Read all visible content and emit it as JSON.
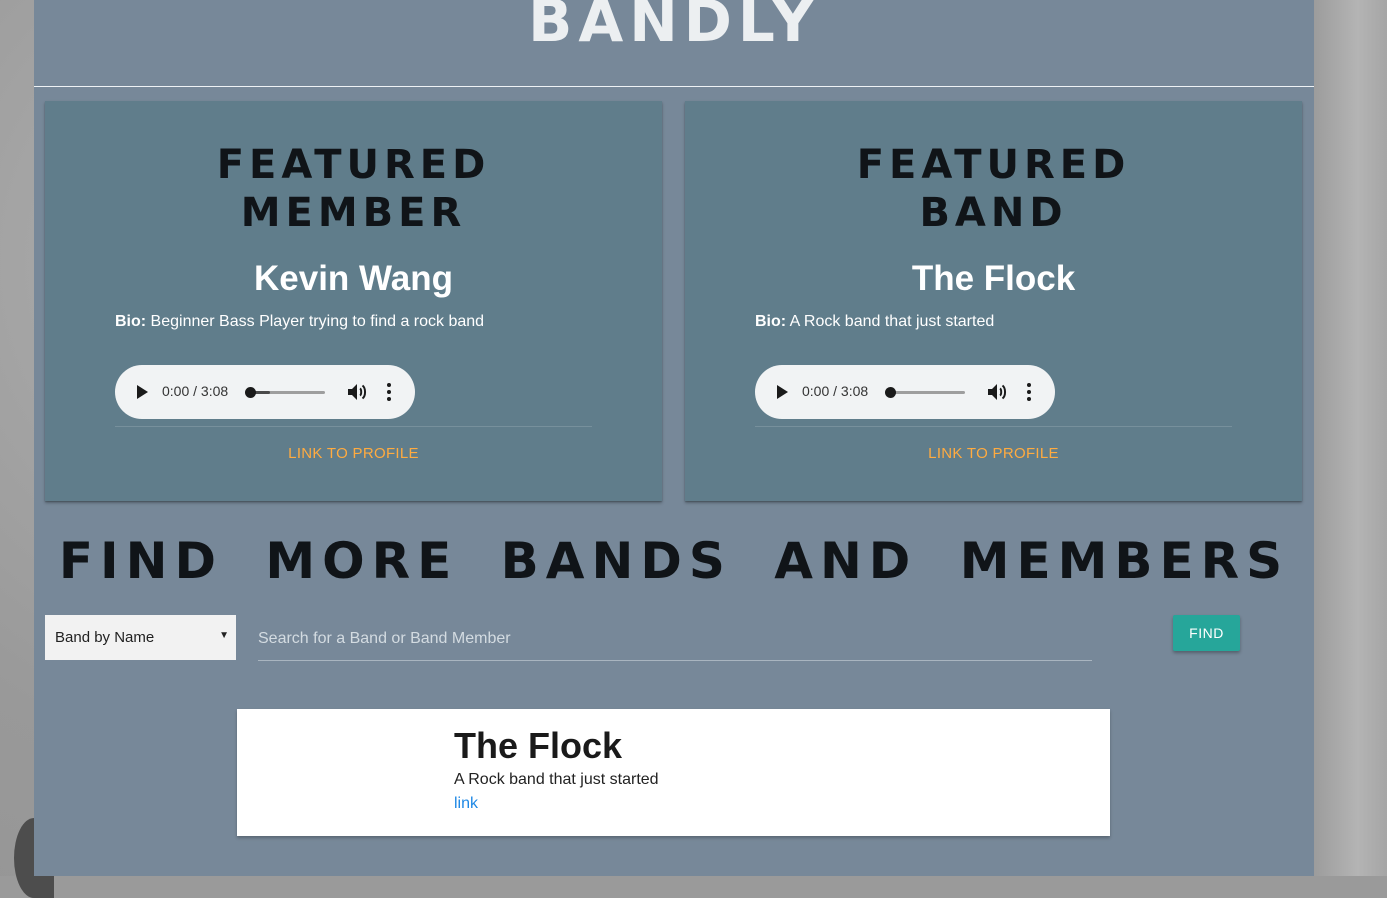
{
  "header": {
    "brand": "BANDLY"
  },
  "featured": [
    {
      "heading": "FEATURED\nMEMBER",
      "name": "Kevin Wang",
      "bio_label": "Bio:",
      "bio": " Beginner Bass Player trying to find a rock band",
      "audio": {
        "time": "0:00 / 3:08",
        "buffered_fraction": 0.27,
        "played_fraction": 0.0
      },
      "link": "LINK TO PROFILE"
    },
    {
      "heading": "FEATURED\nBAND",
      "name": "The Flock",
      "bio_label": "Bio:",
      "bio": " A Rock band that just started",
      "audio": {
        "time": "0:00 / 3:08",
        "buffered_fraction": 0.0,
        "played_fraction": 0.0
      },
      "link": "LINK TO PROFILE"
    }
  ],
  "search": {
    "title": "FIND MORE BANDS AND MEMBERS",
    "select_value": "Band by Name",
    "placeholder": "Search for a Band or Band Member",
    "button": "FIND"
  },
  "results": [
    {
      "name": "The Flock",
      "bio": "A Rock band that just started",
      "link": "link"
    }
  ],
  "colors": {
    "page_bg": "#778899",
    "card_bg": "#607d8b",
    "accent_link": "#ffab40",
    "find_button": "#26a69a",
    "result_link": "#1e88e5"
  }
}
